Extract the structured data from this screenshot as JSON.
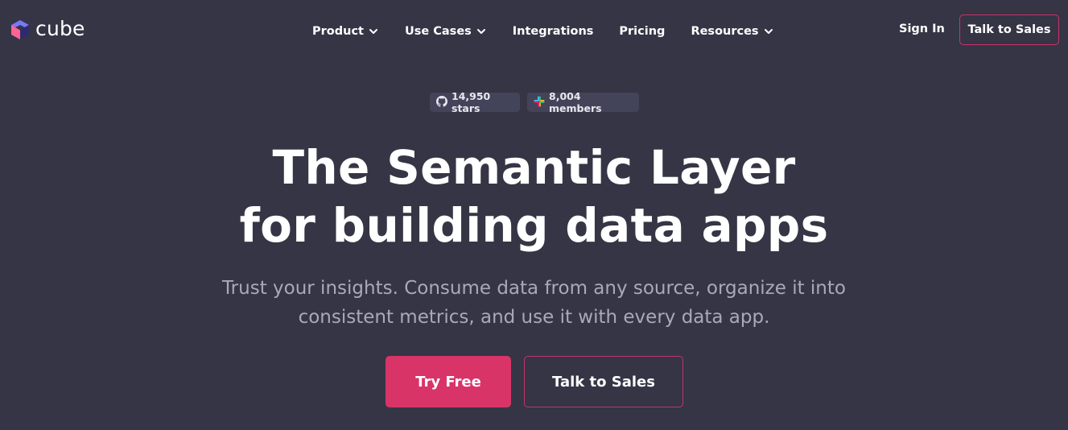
{
  "brand": {
    "name": "cube",
    "logo_icon": "cube-logo-icon",
    "logo_colors": [
      "#7a77ff",
      "#ff6492",
      "#2e2a6e"
    ]
  },
  "nav": {
    "items": [
      {
        "label": "Product",
        "has_dropdown": true
      },
      {
        "label": "Use Cases",
        "has_dropdown": true
      },
      {
        "label": "Integrations",
        "has_dropdown": false
      },
      {
        "label": "Pricing",
        "has_dropdown": false
      },
      {
        "label": "Resources",
        "has_dropdown": true
      }
    ],
    "dropdown_icon": "chevron-down-icon"
  },
  "header": {
    "sign_in_label": "Sign In",
    "cta_label": "Talk to Sales"
  },
  "badges": {
    "github": {
      "icon": "github-icon",
      "label": "14,950 stars"
    },
    "slack": {
      "icon": "slack-icon",
      "label": "8,004 members"
    }
  },
  "hero": {
    "headline_line1": "The Semantic Layer",
    "headline_line2": "for building data apps",
    "subtext_line1": "Trust your insights. Consume data from any source, organize it into",
    "subtext_line2": "consistent metrics, and use it with every data app.",
    "primary_cta": "Try Free",
    "secondary_cta": "Talk to Sales"
  },
  "colors": {
    "background": "#353545",
    "accent": "#d83468",
    "badge_bg": "#43435a",
    "subtext": "#a9a9bb"
  }
}
